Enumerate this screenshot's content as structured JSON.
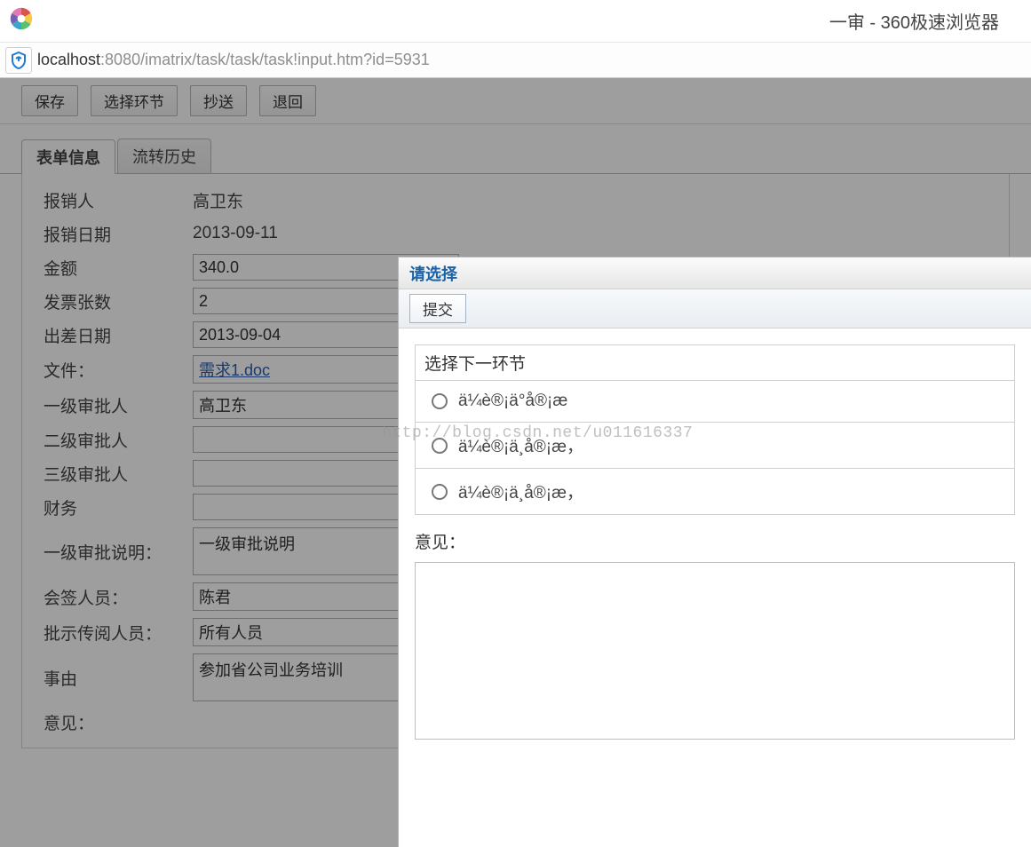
{
  "browser": {
    "tab_title": "一审 - 360极速浏览器",
    "url_host": "localhost",
    "url_rest": ":8080/imatrix/task/task/task!input.htm?id=5931"
  },
  "toolbar": {
    "save": "保存",
    "choose_step": "选择环节",
    "cc": "抄送",
    "return": "退回"
  },
  "tabs": {
    "form_info": "表单信息",
    "flow_history": "流转历史"
  },
  "form": {
    "applicant_label": "报销人",
    "applicant_value": "高卫东",
    "apply_date_label": "报销日期",
    "apply_date_value": "2013-09-11",
    "amount_label": "金额",
    "amount_value": "340.0",
    "invoice_count_label": "发票张数",
    "invoice_count_value": "2",
    "trip_date_label": "出差日期",
    "trip_date_value": "2013-09-04",
    "file_label": "文件：",
    "file_value": "需求1.doc",
    "approver1_label": "一级审批人",
    "approver1_value": "高卫东",
    "approver2_label": "二级审批人",
    "approver2_value": "",
    "approver3_label": "三级审批人",
    "approver3_value": "",
    "finance_label": "财务",
    "finance_value": "",
    "approve1_desc_label": "一级审批说明：",
    "approve1_desc_value": "一级审批说明",
    "cosigner_label": "会签人员：",
    "cosigner_value": "陈君",
    "circulate_label": "批示传阅人员：",
    "circulate_value": "所有人员",
    "reason_label": "事由",
    "reason_value": "参加省公司业务培训",
    "opinion_label": "意见："
  },
  "modal": {
    "title": "请选择",
    "submit": "提交",
    "options_header": "选择下一环节",
    "options": [
      "ä¼è®¡ä°å®¡æ",
      "ä¼è®¡ä¸å®¡æ，",
      "ä¼è®¡ä¸å®¡æ，"
    ],
    "opinion_label": "意见："
  },
  "watermark": "http://blog.csdn.net/u011616337"
}
